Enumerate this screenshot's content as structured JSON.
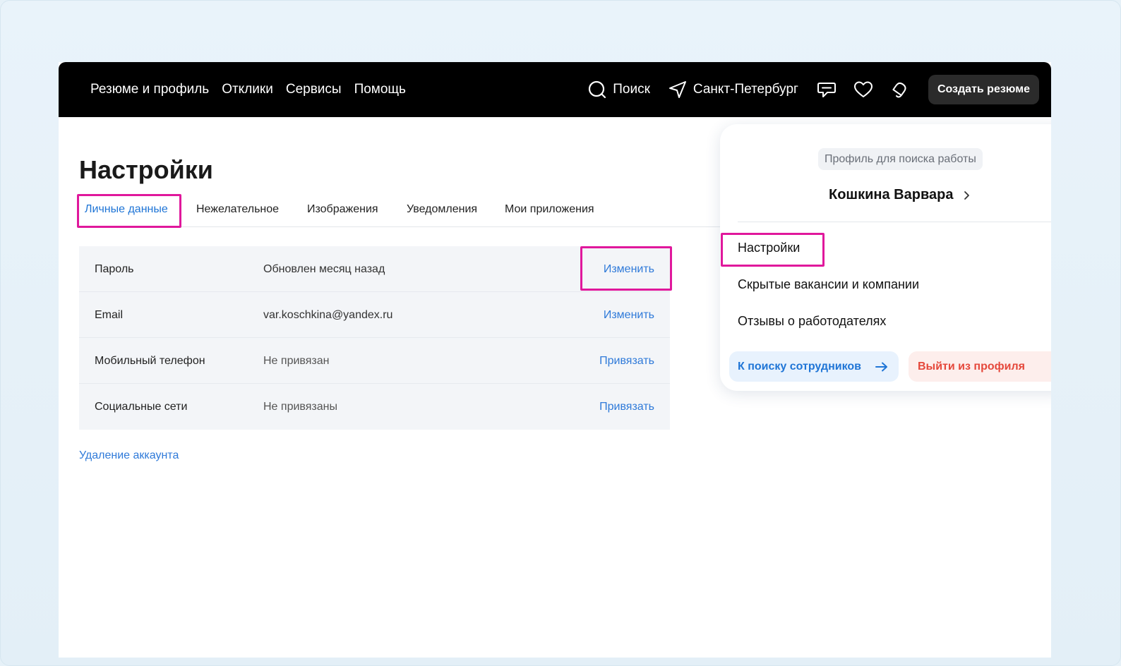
{
  "header": {
    "nav": [
      "Резюме и профиль",
      "Отклики",
      "Сервисы",
      "Помощь"
    ],
    "search_label": "Поиск",
    "location_label": "Санкт-Петербург",
    "create_button": "Создать резюме",
    "icons": [
      "search-icon",
      "location-arrow-icon",
      "chat-icon",
      "heart-icon",
      "bell-icon"
    ]
  },
  "page": {
    "title": "Настройки",
    "tabs": [
      "Личные данные",
      "Нежелательное",
      "Изображения",
      "Уведомления",
      "Мои приложения"
    ],
    "active_tab": "Личные данные"
  },
  "settings": {
    "rows": [
      {
        "label": "Пароль",
        "value": "Обновлен месяц назад",
        "action": "Изменить"
      },
      {
        "label": "Email",
        "value": "var.koschkina@yandex.ru",
        "action": "Изменить"
      },
      {
        "label": "Мобильный телефон",
        "value": "Не привязан",
        "action": "Привязать"
      },
      {
        "label": "Социальные сети",
        "value": "Не привязаны",
        "action": "Привязать"
      }
    ],
    "delete_account": "Удаление аккаунта"
  },
  "dropdown": {
    "badge": "Профиль для поиска работы",
    "user_name": "Кошкина Варвара",
    "items": [
      "Настройки",
      "Скрытые вакансии и компании",
      "Отзывы о работодателях"
    ],
    "employer_button": "К поиску сотрудников",
    "logout_button": "Выйти из профиля"
  },
  "colors": {
    "accent_blue": "#2f7ad9",
    "highlight_magenta": "#e0189c",
    "logout_red": "#e5483b"
  }
}
